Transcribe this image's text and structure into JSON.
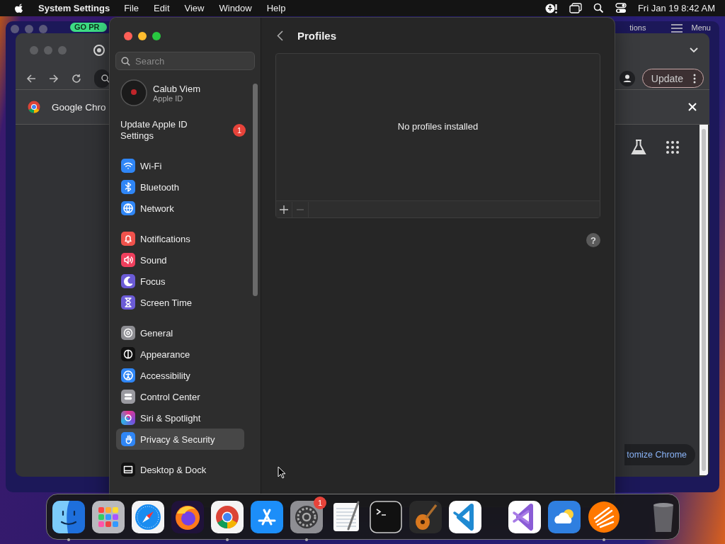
{
  "menu_bar": {
    "app_name": "System Settings",
    "menus": [
      "File",
      "Edit",
      "View",
      "Window",
      "Help"
    ],
    "clock": "Fri Jan 19 8:42 AM"
  },
  "background_window": {
    "button": "GO PR",
    "link": "tions",
    "menu_label": "Menu"
  },
  "browser": {
    "update_button": "Update",
    "info_bar": {
      "text": "Google Chro"
    },
    "customize_button": "tomize Chrome"
  },
  "settings": {
    "search": {
      "placeholder": "Search"
    },
    "account": {
      "name": "Calub Viem",
      "subtitle": "Apple ID"
    },
    "notice": {
      "label": "Update Apple ID Settings",
      "badge": "1"
    },
    "groups": [
      [
        {
          "label": "Wi-Fi",
          "kind": "wifi",
          "selected": false
        },
        {
          "label": "Bluetooth",
          "kind": "bluetooth",
          "selected": false
        },
        {
          "label": "Network",
          "kind": "network",
          "selected": false
        }
      ],
      [
        {
          "label": "Notifications",
          "kind": "notifications",
          "selected": false
        },
        {
          "label": "Sound",
          "kind": "sound",
          "selected": false
        },
        {
          "label": "Focus",
          "kind": "focus",
          "selected": false
        },
        {
          "label": "Screen Time",
          "kind": "screentime",
          "selected": false
        }
      ],
      [
        {
          "label": "General",
          "kind": "general",
          "selected": false
        },
        {
          "label": "Appearance",
          "kind": "appearance",
          "selected": false
        },
        {
          "label": "Accessibility",
          "kind": "accessibility",
          "selected": false
        },
        {
          "label": "Control Center",
          "kind": "controlcenter",
          "selected": false
        },
        {
          "label": "Siri & Spotlight",
          "kind": "siri",
          "selected": false
        },
        {
          "label": "Privacy & Security",
          "kind": "privacy",
          "selected": true
        }
      ],
      [
        {
          "label": "Desktop & Dock",
          "kind": "desktop",
          "selected": false
        }
      ]
    ],
    "page": {
      "title": "Profiles",
      "empty_text": "No profiles installed",
      "help": "?"
    }
  },
  "dock": [
    {
      "kind": "finder",
      "running": true
    },
    {
      "kind": "launchpad",
      "running": false
    },
    {
      "kind": "safari",
      "running": false
    },
    {
      "kind": "firefox",
      "running": false
    },
    {
      "kind": "chrome",
      "running": true
    },
    {
      "kind": "appstore",
      "running": false
    },
    {
      "kind": "settings",
      "running": true,
      "badge": "1"
    },
    {
      "kind": "textedit",
      "running": false
    },
    {
      "kind": "terminal",
      "running": false
    },
    {
      "kind": "garageband",
      "running": false
    },
    {
      "kind": "vscode",
      "running": false
    },
    {
      "kind": "divider"
    },
    {
      "kind": "visualstudio",
      "running": false
    },
    {
      "kind": "weather",
      "running": false
    },
    {
      "kind": "avast",
      "running": true
    },
    {
      "kind": "divider"
    },
    {
      "kind": "trash",
      "running": false
    }
  ]
}
